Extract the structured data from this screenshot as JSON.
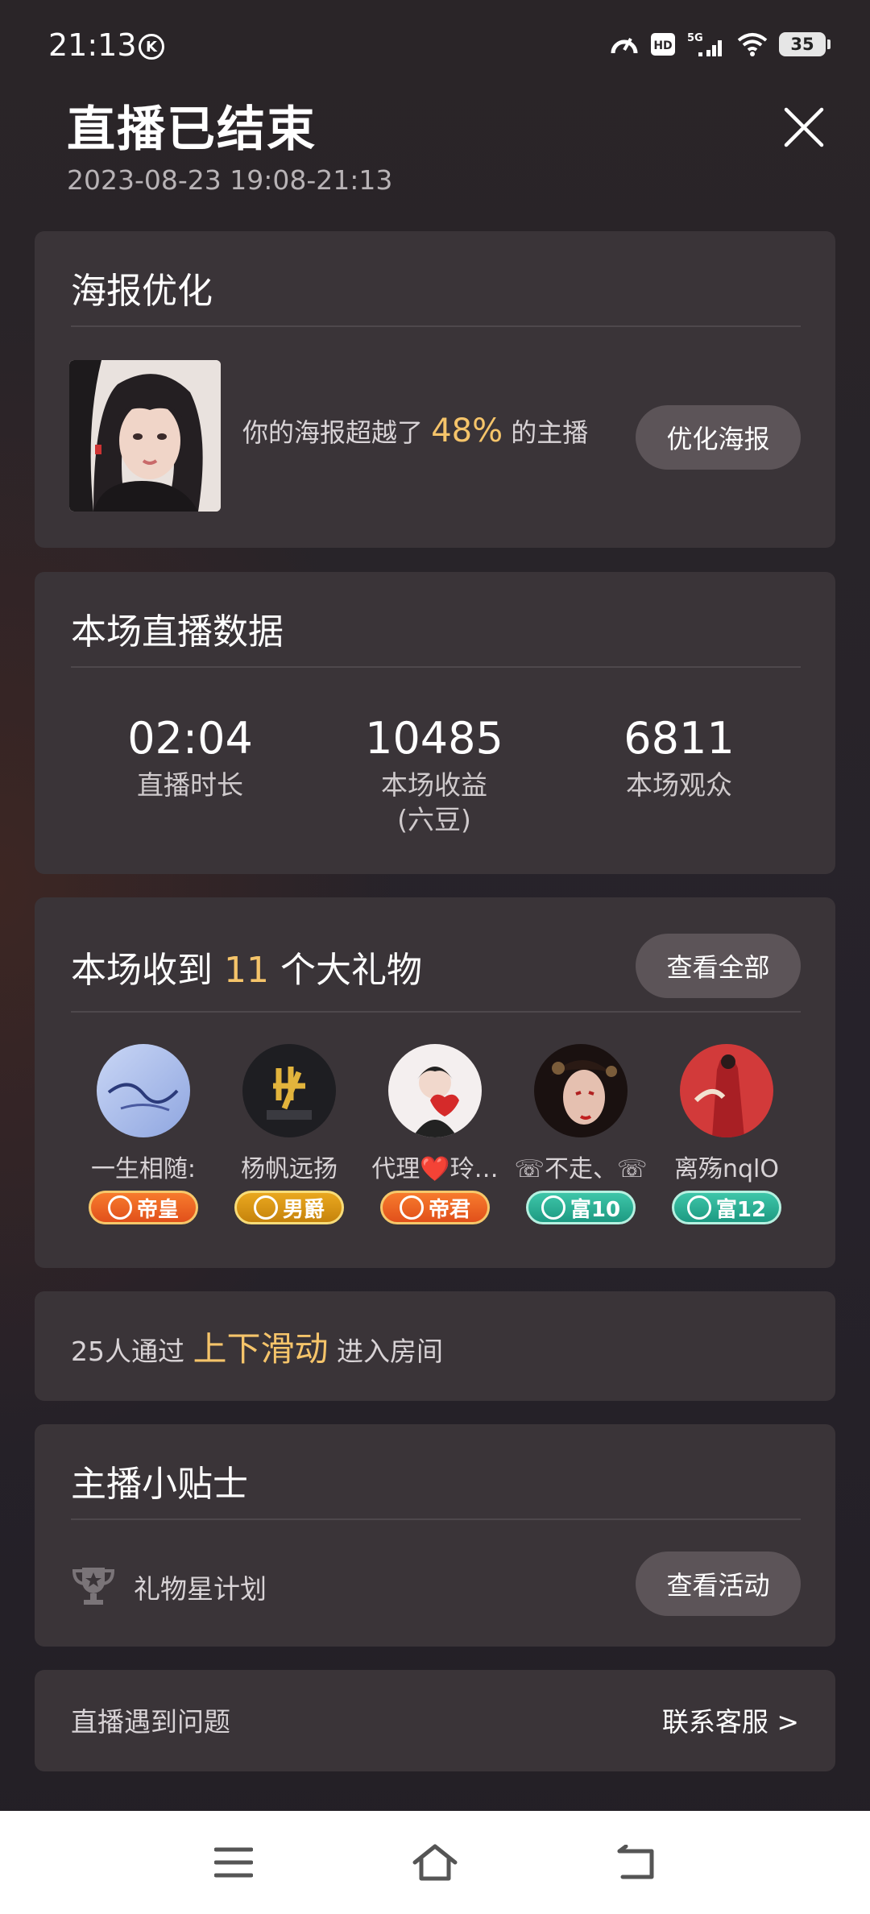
{
  "status_bar": {
    "time": "21:13",
    "k_icon": "K",
    "battery": "35",
    "icons": [
      "speedometer-icon",
      "hd-icon",
      "5g-signal-icon",
      "wifi-icon",
      "battery-icon"
    ]
  },
  "header": {
    "title": "直播已结束",
    "time_range": "2023-08-23 19:08-21:13",
    "close_icon": "close-icon"
  },
  "poster": {
    "title": "海报优化",
    "text_before": "你的海报超越了 ",
    "percent": "48%",
    "text_after": " 的主播",
    "button": "优化海报"
  },
  "stats": {
    "title": "本场直播数据",
    "items": [
      {
        "value": "02:04",
        "label": "直播时长",
        "sub": ""
      },
      {
        "value": "10485",
        "label": "本场收益",
        "sub": "(六豆)"
      },
      {
        "value": "6811",
        "label": "本场观众",
        "sub": ""
      }
    ]
  },
  "gifts": {
    "title_before": "本场收到 ",
    "count": "11",
    "title_after": " 个大礼物",
    "button": "查看全部",
    "givers": [
      {
        "name": "一生相随:",
        "badge": "帝皇",
        "badge_style": "orange"
      },
      {
        "name": "杨帆远扬",
        "badge": "男爵",
        "badge_style": "gold"
      },
      {
        "name": "代理❤️玲…",
        "badge": "帝君",
        "badge_style": "orange"
      },
      {
        "name": "☏不走、☏",
        "badge": "富10",
        "badge_style": "teal"
      },
      {
        "name": "离殇nqlO",
        "badge": "富12",
        "badge_style": "teal"
      }
    ]
  },
  "slide": {
    "text_before": "25人通过 ",
    "highlight": "上下滑动",
    "text_after": " 进入房间"
  },
  "tips": {
    "title": "主播小贴士",
    "item_label": "礼物星计划",
    "button": "查看活动"
  },
  "support": {
    "problem": "直播遇到问题",
    "contact": "联系客服 >"
  },
  "colors": {
    "highlight": "#f5c46a",
    "card": "#3a3438",
    "pill": "#5c5458"
  }
}
